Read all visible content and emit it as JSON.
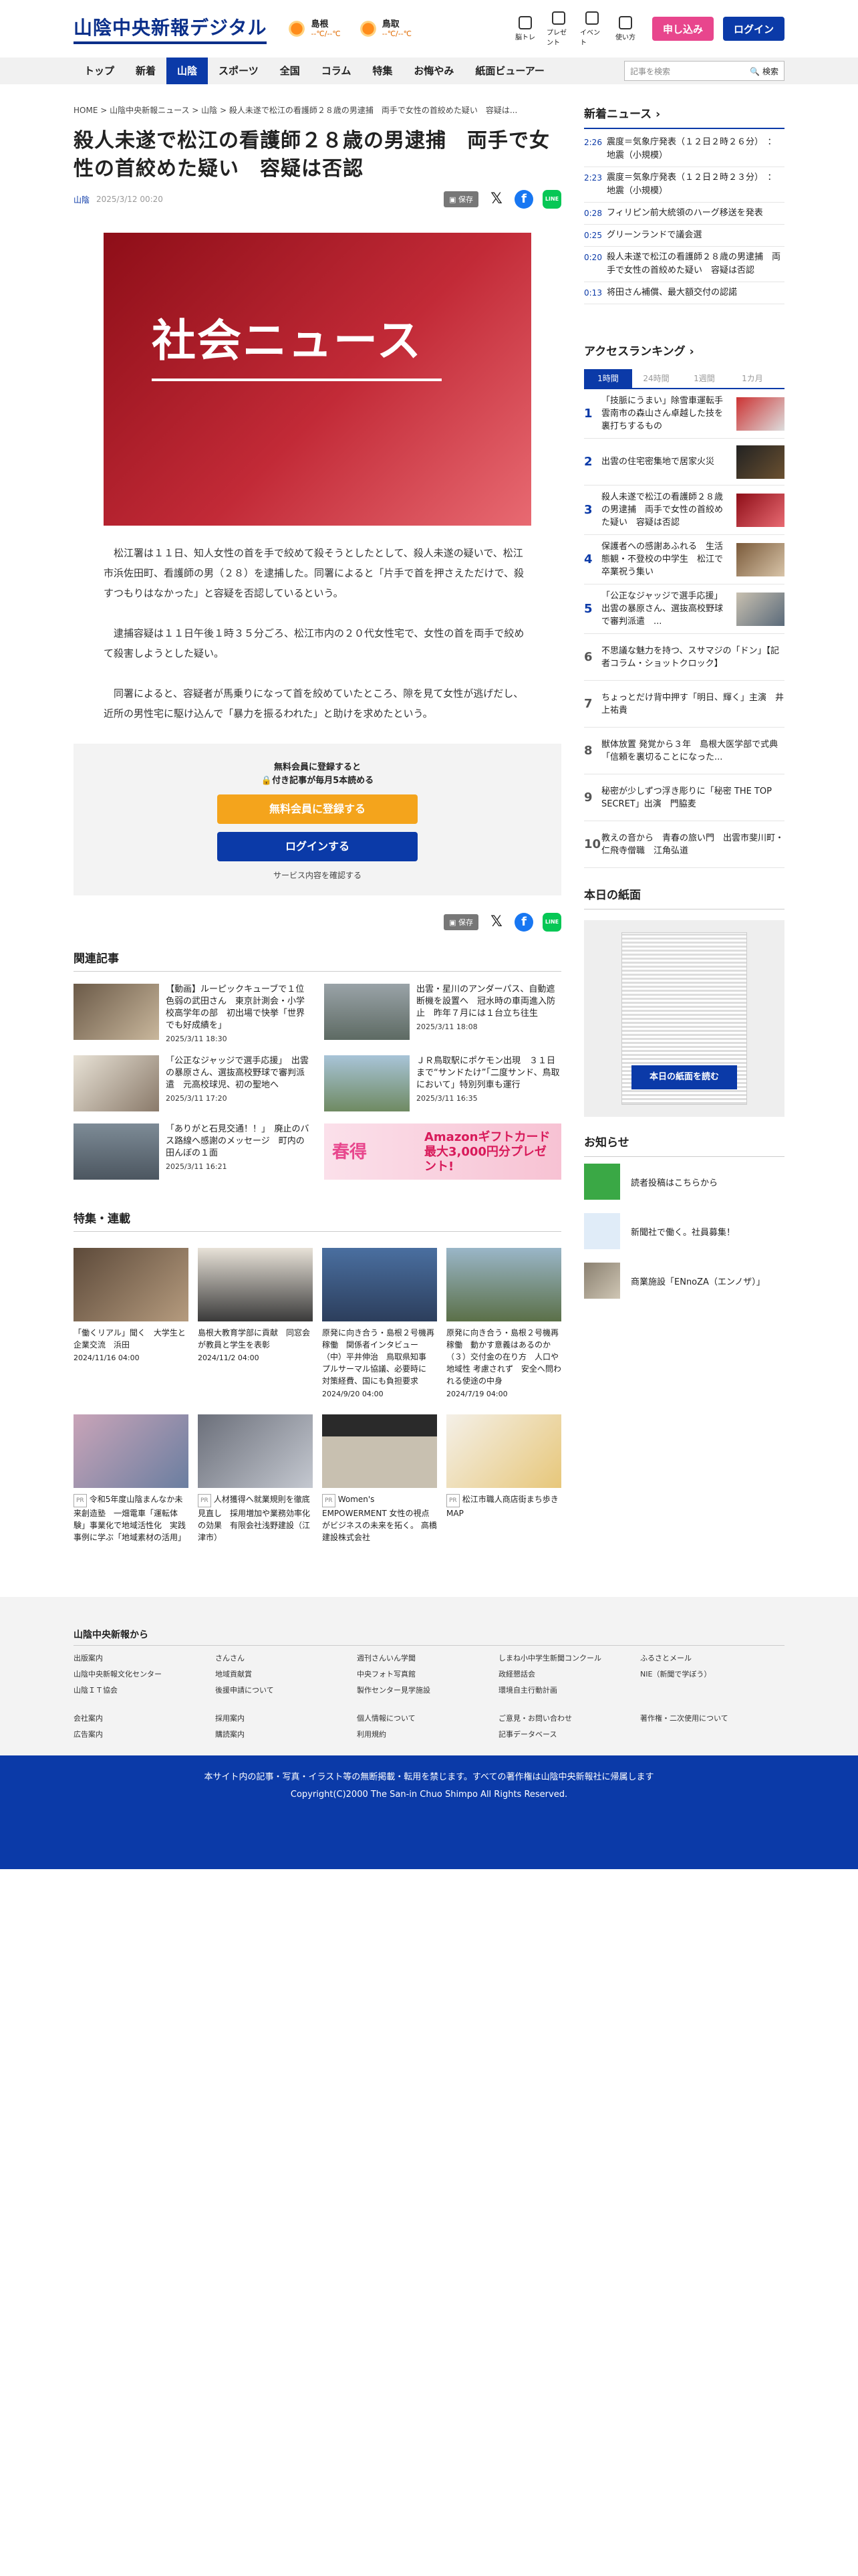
{
  "header": {
    "logo": "山陰中央新報デジタル",
    "weather": [
      {
        "name": "島根",
        "temp": "--℃/--℃"
      },
      {
        "name": "鳥取",
        "temp": "--℃/--℃"
      }
    ],
    "icons": [
      "脳トレ",
      "プレゼント",
      "イベント",
      "使い方"
    ],
    "subscribe": "申し込み",
    "login": "ログイン"
  },
  "nav": {
    "items": [
      "トップ",
      "新着",
      "山陰",
      "スポーツ",
      "全国",
      "コラム",
      "特集",
      "お悔やみ",
      "紙面ビューアー"
    ],
    "search_placeholder": "記事を検索",
    "search_btn": "検索"
  },
  "article": {
    "breadcrumb": "HOME > 山陰中央新報ニュース > 山陰 > 殺人未遂で松江の看護師２８歳の男逮捕　両手で女性の首絞めた疑い　容疑は...",
    "title": "殺人未遂で松江の看護師２８歳の男逮捕　両手で女性の首絞めた疑い　容疑は否認",
    "category": "山陰",
    "date": "2025/3/12 00:20",
    "save": "保存",
    "hero_text": "社会ニュース",
    "paragraphs": [
      "松江署は１１日、知人女性の首を手で絞めて殺そうとしたとして、殺人未遂の疑いで、松江市浜佐田町、看護師の男（２８）を逮捕した。同署によると「片手で首を押さえただけで、殺すつもりはなかった」と容疑を否認しているという。",
      "逮捕容疑は１１日午後１時３５分ごろ、松江市内の２０代女性宅で、女性の首を両手で絞めて殺害しようとした疑い。",
      "同署によると、容疑者が馬乗りになって首を絞めていたところ、隙を見て女性が逃げだし、近所の男性宅に駆け込んで「暴力を振るわれた」と助けを求めたという。"
    ]
  },
  "paywall": {
    "line1": "無料会員に登録すると",
    "line2": "付き記事が毎月5本読める",
    "free": "無料会員に登録する",
    "login": "ログインする",
    "note": "サービス内容を確認する"
  },
  "related": {
    "heading": "関連記事",
    "items": [
      {
        "title": "【動画】ルーピックキューブで１位　色弱の武田さん　東京計測会・小学校高学年の部　初出場で快挙「世界でも好成績を」",
        "date": "2025/3/11 18:30"
      },
      {
        "title": "出雲・星川のアンダーパス、自動遮断機を設置へ　冠水時の車両進入防止　昨年７月には１台立ち往生",
        "date": "2025/3/11 18:08"
      },
      {
        "title": "「公正なジャッジで選手応援」　出雲の暴原さん、選抜高校野球で審判派遣　元高校球児、初の聖地へ",
        "date": "2025/3/11 17:20"
      },
      {
        "title": "ＪＲ鳥取駅にポケモン出現　３１日まで“サンドたけ”「二度サンド、鳥取において」特別列車も運行",
        "date": "2025/3/11 16:35"
      },
      {
        "title": "「ありがと石見交通！！」　廃止のバス路線へ感謝のメッセージ　町内の田んぼの１面",
        "date": "2025/3/11 16:21"
      }
    ],
    "ad": {
      "a1": "春得",
      "a2": "Amazonギフトカード最大3,000円分プレゼント!"
    }
  },
  "tokushu": {
    "heading": "特集・連載",
    "items": [
      {
        "title": "「働くリアル」聞く　大学生と企業交流　浜田",
        "date": "2024/11/16 04:00"
      },
      {
        "title": "島根大教育学部に貢献　同窓会が教員と学生を表彰",
        "date": "2024/11/2 04:00"
      },
      {
        "title": "原発に向き合う・島根２号機再稼働　関係者インタビュー（中）平井伸治　鳥取県知事　プルサーマル協議、必要時に　対策経費、国にも負担要求",
        "date": "2024/9/20 04:00"
      },
      {
        "title": "原発に向き合う・島根２号機再稼働　動かす意義はあるのか（３）交付金の在り方　人口や地域性 考慮されず　安全へ問われる使途の中身",
        "date": "2024/7/19 04:00"
      },
      {
        "title": "令和5年度山陰まんなか未来創造塾　一畑電車「運転体験」事業化で地域活性化　実践事例に学ぶ「地域素材の活用」",
        "pr": "PR"
      },
      {
        "title": "人材獲得へ就業規則を徹底見直し　採用増加や業務効率化の効果　有限会社浅野建設（江津市）",
        "pr": "PR"
      },
      {
        "title": "Women's EMPOWERMENT 女性の視点がビジネスの未来を拓く。 高橋建設株式会社",
        "pr": "PR"
      },
      {
        "title": "松江市職人商店街まち歩きMAP",
        "pr": "PR"
      }
    ]
  },
  "side": {
    "news_heading": "新着ニュース",
    "news": [
      {
        "time": "2:26",
        "text": "震度＝気象庁発表（１２日２時２６分）　：地震（小規模）"
      },
      {
        "time": "2:23",
        "text": "震度＝気象庁発表（１２日２時２３分）　：地震（小規模）"
      },
      {
        "time": "0:28",
        "text": "フィリピン前大統領のハーグ移送を発表"
      },
      {
        "time": "0:25",
        "text": "グリーンランドで議会選"
      },
      {
        "time": "0:20",
        "text": "殺人未遂で松江の看護師２８歳の男逮捕　両手で女性の首絞めた疑い　容疑は否認"
      },
      {
        "time": "0:13",
        "text": "将田さん補償、最大額交付の認諾"
      }
    ],
    "ranking_heading": "アクセスランキング",
    "tabs": [
      "1時間",
      "24時間",
      "1週間",
      "1カ月"
    ],
    "ranking": [
      {
        "n": "1",
        "t": "「技脈にうまい」除雪車運転手　雲南市の森山さん卓越した技を裏打ちするもの"
      },
      {
        "n": "2",
        "t": "出雲の住宅密集地で居家火災"
      },
      {
        "n": "3",
        "t": "殺人未遂で松江の看護師２８歳の男逮捕　両手で女性の首絞めた疑い　容疑は否認"
      },
      {
        "n": "4",
        "t": "保護者への感謝あふれる　生活態観・不登校の中学生　松江で卒業祝う集い"
      },
      {
        "n": "5",
        "t": "「公正なジャッジで選手応援」出雲の暴原さん、選抜高校野球で審判派遣　..."
      },
      {
        "n": "6",
        "t": "不思議な魅力を持つ、スサマジの「ドン」【記者コラム・ショットクロック】"
      },
      {
        "n": "7",
        "t": "ちょっとだけ背中押す「明日、輝く」主演　井上祐貴"
      },
      {
        "n": "8",
        "t": "獣体放置 発覚から３年　島根大医学部で式典「信頼を裏切ることになった..."
      },
      {
        "n": "9",
        "t": "秘密が少しずつ浮き彫りに「秘密 THE TOP SECRET」出演　門脇麦"
      },
      {
        "n": "10",
        "t": "教えの音から　青春の旅い門　出雲市斐川町・仁飛寺僧職　江角弘道"
      }
    ],
    "paper_heading": "本日の紙面",
    "paper_btn": "本日の紙面を読む",
    "oshirase_heading": "お知らせ",
    "oshirase": [
      "読者投稿はこちらから",
      "新聞社で働く。社員募集！",
      "商業施設「ENnoZA（エンノザ）」"
    ]
  },
  "footer": {
    "heading": "山陰中央新報から",
    "links": [
      "出版案内",
      "さんさん",
      "週刊さんいん学聞",
      "しまね小中学生新聞コンクール",
      "ふるさとメール",
      "山陰中央新報文化センター",
      "地域貢献賞",
      "中央フォト写真館",
      "政経懇話会",
      "NIE（新聞で学ぼう）",
      "山陰ＩＴ協会",
      "後援申請について",
      "製作センター見学施設",
      "環境自主行動計画",
      "",
      "会社案内",
      "採用案内",
      "個人情報について",
      "ご意見・お問い合わせ",
      "著作権・二次使用について",
      "広告案内",
      "購読案内",
      "利用規約",
      "記事データベース",
      ""
    ],
    "notice": "本サイト内の記事・写真・イラスト等の無断掲載・転用を禁じます。すべての著作権は山陰中央新報社に帰属します",
    "copyright": "Copyright(C)2000 The San-in Chuo Shimpo All Rights Reserved."
  }
}
